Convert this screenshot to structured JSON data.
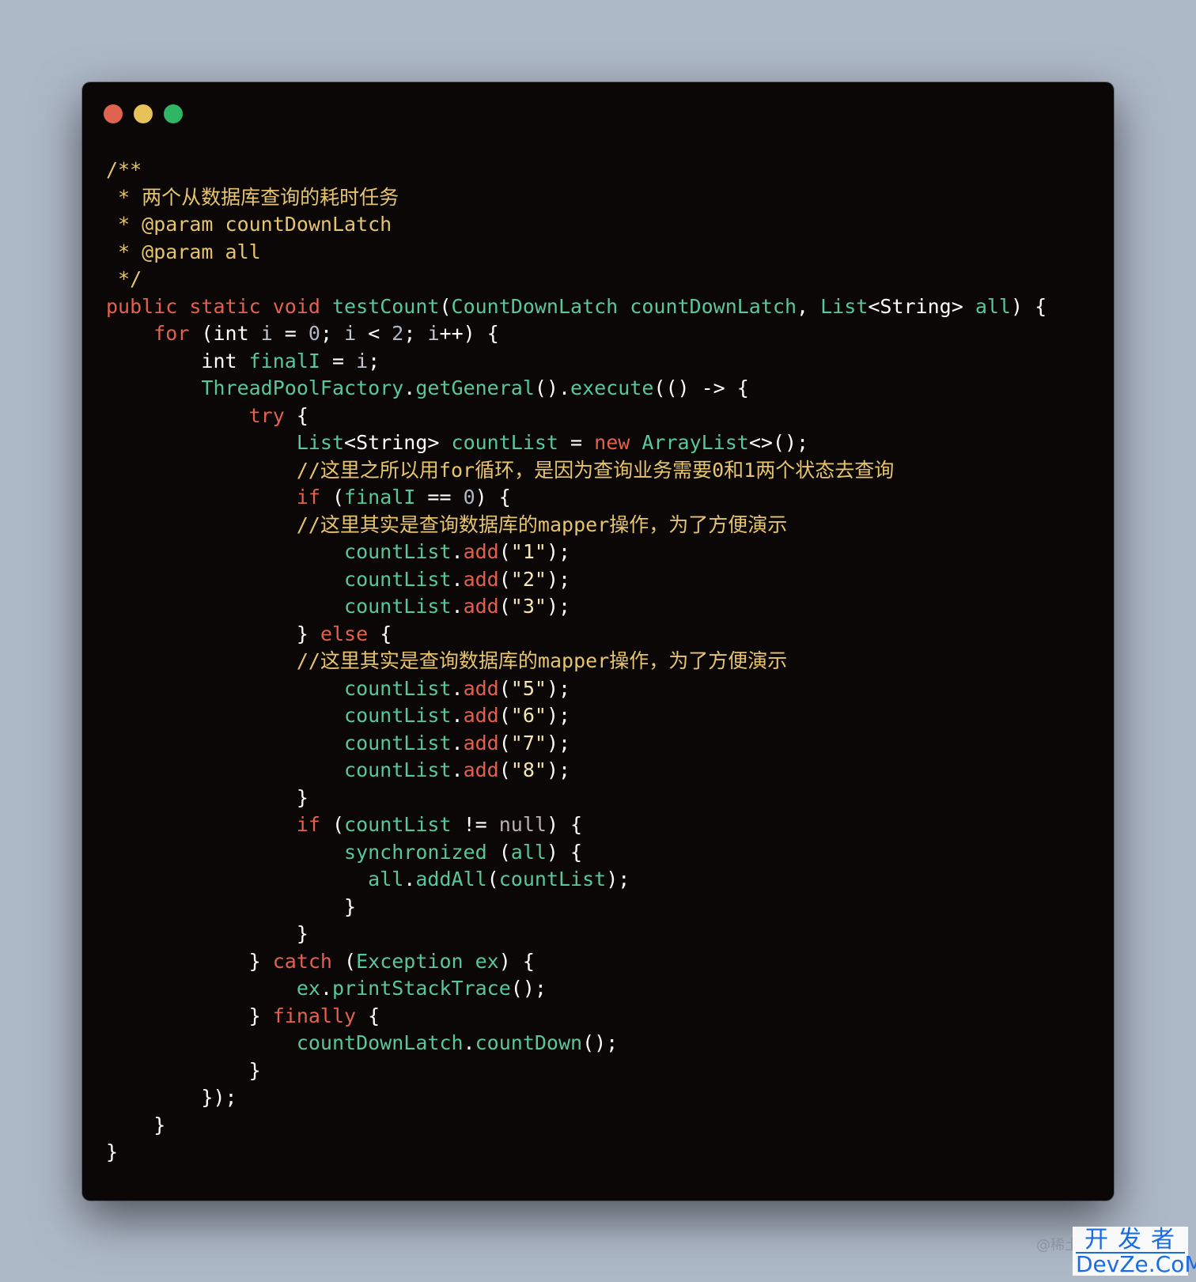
{
  "window": {
    "buttons": [
      {
        "name": "close",
        "color": "#e0634f"
      },
      {
        "name": "minimize",
        "color": "#e7c15a"
      },
      {
        "name": "zoom",
        "color": "#2fb564"
      }
    ]
  },
  "code_lines": [
    [
      [
        "cmt",
        "/**"
      ]
    ],
    [
      [
        "cmt",
        " * 两个从数据库查询的耗时任务"
      ]
    ],
    [
      [
        "cmt",
        " * @param countDownLatch"
      ]
    ],
    [
      [
        "cmt",
        " * @param all"
      ]
    ],
    [
      [
        "cmt",
        " */"
      ]
    ],
    [
      [
        "kw",
        "public static void "
      ],
      [
        "fn",
        "testCount"
      ],
      [
        "op",
        "("
      ],
      [
        "fn",
        "CountDownLatch countDownLatch"
      ],
      [
        "op",
        ", "
      ],
      [
        "fn",
        "List"
      ],
      [
        "op",
        "<String> "
      ],
      [
        "fn",
        "all"
      ],
      [
        "op",
        ") {"
      ]
    ],
    [
      [
        "op",
        "    "
      ],
      [
        "kw",
        "for"
      ],
      [
        "op",
        " (int "
      ],
      [
        "var",
        "i"
      ],
      [
        "op",
        " = "
      ],
      [
        "num",
        "0"
      ],
      [
        "op",
        "; "
      ],
      [
        "var",
        "i"
      ],
      [
        "op",
        " < "
      ],
      [
        "num",
        "2"
      ],
      [
        "op",
        "; "
      ],
      [
        "var",
        "i"
      ],
      [
        "op",
        "++) {"
      ]
    ],
    [
      [
        "op",
        "        int "
      ],
      [
        "fn",
        "finalI"
      ],
      [
        "op",
        " = "
      ],
      [
        "var",
        "i"
      ],
      [
        "op",
        ";"
      ]
    ],
    [
      [
        "op",
        "        "
      ],
      [
        "fn",
        "ThreadPoolFactory"
      ],
      [
        "op",
        "."
      ],
      [
        "fn",
        "getGeneral"
      ],
      [
        "op",
        "()."
      ],
      [
        "fn",
        "execute"
      ],
      [
        "op",
        "(() -> {"
      ]
    ],
    [
      [
        "op",
        "            "
      ],
      [
        "kw",
        "try"
      ],
      [
        "op",
        " {"
      ]
    ],
    [
      [
        "op",
        "                "
      ],
      [
        "fn",
        "List"
      ],
      [
        "op",
        "<String> "
      ],
      [
        "fn",
        "countList"
      ],
      [
        "op",
        " = "
      ],
      [
        "kw",
        "new "
      ],
      [
        "fn",
        "ArrayList"
      ],
      [
        "op",
        "<>();"
      ]
    ],
    [
      [
        "op",
        "                "
      ],
      [
        "cmt",
        "//这里之所以用for循环，是因为查询业务需要0和1两个状态去查询"
      ]
    ],
    [
      [
        "op",
        "                "
      ],
      [
        "kw",
        "if"
      ],
      [
        "op",
        " ("
      ],
      [
        "fn",
        "finalI"
      ],
      [
        "op",
        " == "
      ],
      [
        "num",
        "0"
      ],
      [
        "op",
        ") {"
      ]
    ],
    [
      [
        "op",
        "                "
      ],
      [
        "cmt",
        "//这里其实是查询数据库的mapper操作，为了方便演示"
      ]
    ],
    [
      [
        "op",
        "                    "
      ],
      [
        "fn",
        "countList"
      ],
      [
        "op",
        "."
      ],
      [
        "kw",
        "add"
      ],
      [
        "op",
        "("
      ],
      [
        "str",
        "\"1\""
      ],
      [
        "op",
        ");"
      ]
    ],
    [
      [
        "op",
        "                    "
      ],
      [
        "fn",
        "countList"
      ],
      [
        "op",
        "."
      ],
      [
        "kw",
        "add"
      ],
      [
        "op",
        "("
      ],
      [
        "str",
        "\"2\""
      ],
      [
        "op",
        ");"
      ]
    ],
    [
      [
        "op",
        "                    "
      ],
      [
        "fn",
        "countList"
      ],
      [
        "op",
        "."
      ],
      [
        "kw",
        "add"
      ],
      [
        "op",
        "("
      ],
      [
        "str",
        "\"3\""
      ],
      [
        "op",
        ");"
      ]
    ],
    [
      [
        "op",
        "                } "
      ],
      [
        "kw",
        "else"
      ],
      [
        "op",
        " {"
      ]
    ],
    [
      [
        "op",
        "                "
      ],
      [
        "cmt",
        "//这里其实是查询数据库的mapper操作，为了方便演示"
      ]
    ],
    [
      [
        "op",
        "                    "
      ],
      [
        "fn",
        "countList"
      ],
      [
        "op",
        "."
      ],
      [
        "kw",
        "add"
      ],
      [
        "op",
        "("
      ],
      [
        "str",
        "\"5\""
      ],
      [
        "op",
        ");"
      ]
    ],
    [
      [
        "op",
        "                    "
      ],
      [
        "fn",
        "countList"
      ],
      [
        "op",
        "."
      ],
      [
        "kw",
        "add"
      ],
      [
        "op",
        "("
      ],
      [
        "str",
        "\"6\""
      ],
      [
        "op",
        ");"
      ]
    ],
    [
      [
        "op",
        "                    "
      ],
      [
        "fn",
        "countList"
      ],
      [
        "op",
        "."
      ],
      [
        "kw",
        "add"
      ],
      [
        "op",
        "("
      ],
      [
        "str",
        "\"7\""
      ],
      [
        "op",
        ");"
      ]
    ],
    [
      [
        "op",
        "                    "
      ],
      [
        "fn",
        "countList"
      ],
      [
        "op",
        "."
      ],
      [
        "kw",
        "add"
      ],
      [
        "op",
        "("
      ],
      [
        "str",
        "\"8\""
      ],
      [
        "op",
        ");"
      ]
    ],
    [
      [
        "op",
        "                }"
      ]
    ],
    [
      [
        "op",
        "                "
      ],
      [
        "kw",
        "if"
      ],
      [
        "op",
        " ("
      ],
      [
        "fn",
        "countList"
      ],
      [
        "op",
        " != "
      ],
      [
        "nul",
        "null"
      ],
      [
        "op",
        ") {"
      ]
    ],
    [
      [
        "op",
        "                    "
      ],
      [
        "fn",
        "synchronized"
      ],
      [
        "op",
        " ("
      ],
      [
        "fn",
        "all"
      ],
      [
        "op",
        ") {"
      ]
    ],
    [
      [
        "op",
        "                      "
      ],
      [
        "fn",
        "all"
      ],
      [
        "op",
        "."
      ],
      [
        "fn",
        "addAll"
      ],
      [
        "op",
        "("
      ],
      [
        "fn",
        "countList"
      ],
      [
        "op",
        ");"
      ]
    ],
    [
      [
        "op",
        "                    }"
      ]
    ],
    [
      [
        "op",
        "                }"
      ]
    ],
    [
      [
        "op",
        "            } "
      ],
      [
        "kw",
        "catch"
      ],
      [
        "op",
        " ("
      ],
      [
        "fn",
        "Exception ex"
      ],
      [
        "op",
        ") {"
      ]
    ],
    [
      [
        "op",
        "                "
      ],
      [
        "fn",
        "ex"
      ],
      [
        "op",
        "."
      ],
      [
        "fn",
        "printStackTrace"
      ],
      [
        "op",
        "();"
      ]
    ],
    [
      [
        "op",
        "            } "
      ],
      [
        "kw",
        "finally"
      ],
      [
        "op",
        " {"
      ]
    ],
    [
      [
        "op",
        "                "
      ],
      [
        "fn",
        "countDownLatch"
      ],
      [
        "op",
        "."
      ],
      [
        "fn",
        "countDown"
      ],
      [
        "op",
        "();"
      ]
    ],
    [
      [
        "op",
        "            }"
      ]
    ],
    [
      [
        "op",
        "        });"
      ]
    ],
    [
      [
        "op",
        "    }"
      ]
    ],
    [
      [
        "op",
        "}"
      ]
    ]
  ],
  "watermark": {
    "small": "@稀土",
    "top": "开发者",
    "bottom": "DevZe.CoM"
  }
}
